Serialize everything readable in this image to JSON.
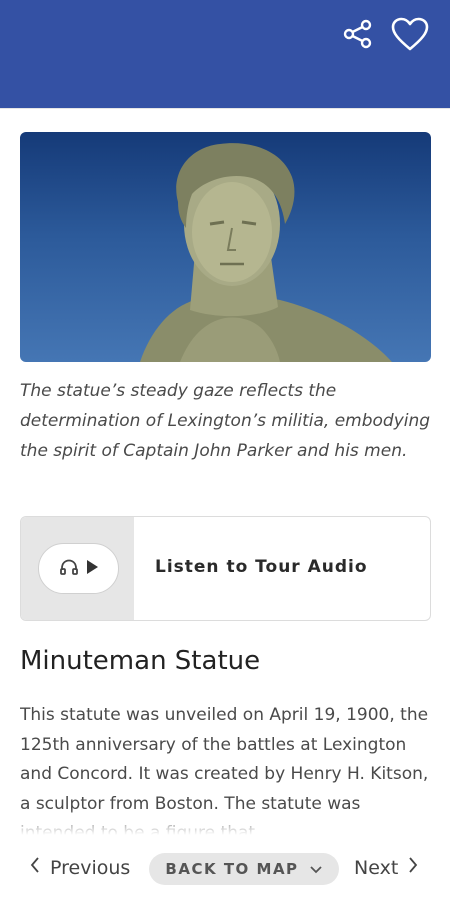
{
  "header": {
    "share_icon": "share-icon",
    "favorite_icon": "heart-icon",
    "background_color": "#3451a4"
  },
  "hero": {
    "caption": "The statue’s steady gaze reflects the determination of Lexington’s militia, embodying the spirit of Captain John Parker and his men."
  },
  "audio": {
    "label": "Listen to Tour Audio",
    "icons": [
      "headphones-icon",
      "play-icon"
    ]
  },
  "stop": {
    "title": "Minuteman Statue",
    "description": "This statute was unveiled on April 19, 1900, the 125th anniversary of the battles at Lexington and Concord. It was created by Henry H. Kitson, a sculptor from Boston. The statute was intended to be a figure that"
  },
  "nav": {
    "previous": "Previous",
    "back_to_map": "BACK TO MAP",
    "next": "Next"
  }
}
